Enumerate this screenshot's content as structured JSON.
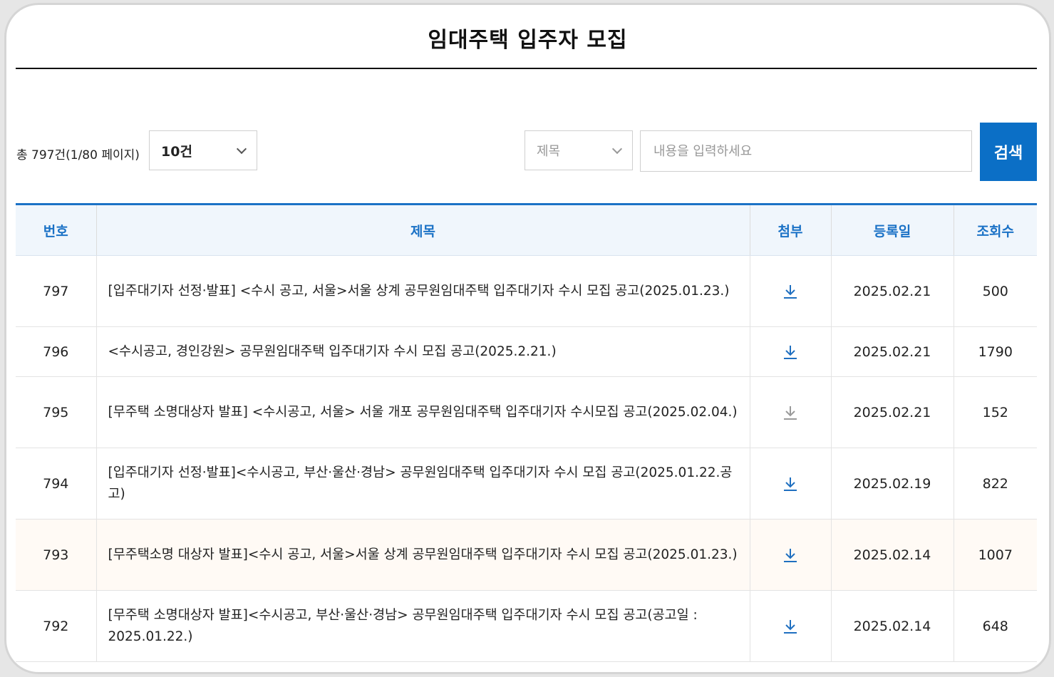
{
  "header": {
    "title": "임대주택 입주자 모집"
  },
  "toolbar": {
    "total_text": "총 797건(1/80 페이지)",
    "page_size_value": "10건",
    "field_value": "제목",
    "search_placeholder": "내용을 입력하세요",
    "search_label": "검색"
  },
  "table": {
    "columns": {
      "number": "번호",
      "title": "제목",
      "attachment": "첨부",
      "date": "등록일",
      "views": "조회수"
    },
    "rows": [
      {
        "number": "797",
        "title": "[입주대기자 선정·발표] <수시 공고, 서울>서울 상계 공무원임대주택 입주대기자 수시 모집 공고(2025.01.23.)",
        "date": "2025.02.21",
        "views": "500"
      },
      {
        "number": "796",
        "title": "<수시공고, 경인강원> 공무원임대주택 입주대기자 수시 모집 공고(2025.2.21.)",
        "date": "2025.02.21",
        "views": "1790"
      },
      {
        "number": "795",
        "title": "[무주택 소명대상자 발표] <수시공고, 서울> 서울 개포 공무원임대주택 입주대기자 수시모집 공고(2025.02.04.)",
        "date": "2025.02.21",
        "views": "152"
      },
      {
        "number": "794",
        "title": "[입주대기자 선정·발표]<수시공고, 부산·울산·경남> 공무원임대주택 입주대기자 수시 모집 공고(2025.01.22.공고)",
        "date": "2025.02.19",
        "views": "822"
      },
      {
        "number": "793",
        "title": "[무주택소명 대상자 발표]<수시 공고, 서울>서울 상계 공무원임대주택 입주대기자 수시 모집 공고(2025.01.23.)",
        "date": "2025.02.14",
        "views": "1007"
      },
      {
        "number": "792",
        "title": "[무주택 소명대상자 발표]<수시공고, 부산·울산·경남> 공무원임대주택 입주대기자 수시 모집 공고(공고일 : 2025.01.22.)",
        "date": "2025.02.14",
        "views": "648"
      }
    ]
  },
  "icons": {
    "attachment": "download-icon",
    "dropdown": "chevron-down-icon"
  },
  "colors": {
    "accent": "#0b6fc6",
    "header_text": "#1b72c6",
    "header_bg": "#f0f6fc",
    "icon_active": "#1f6fc0",
    "icon_muted": "#9a9a9a",
    "highlight_row": "#fffaf5"
  }
}
